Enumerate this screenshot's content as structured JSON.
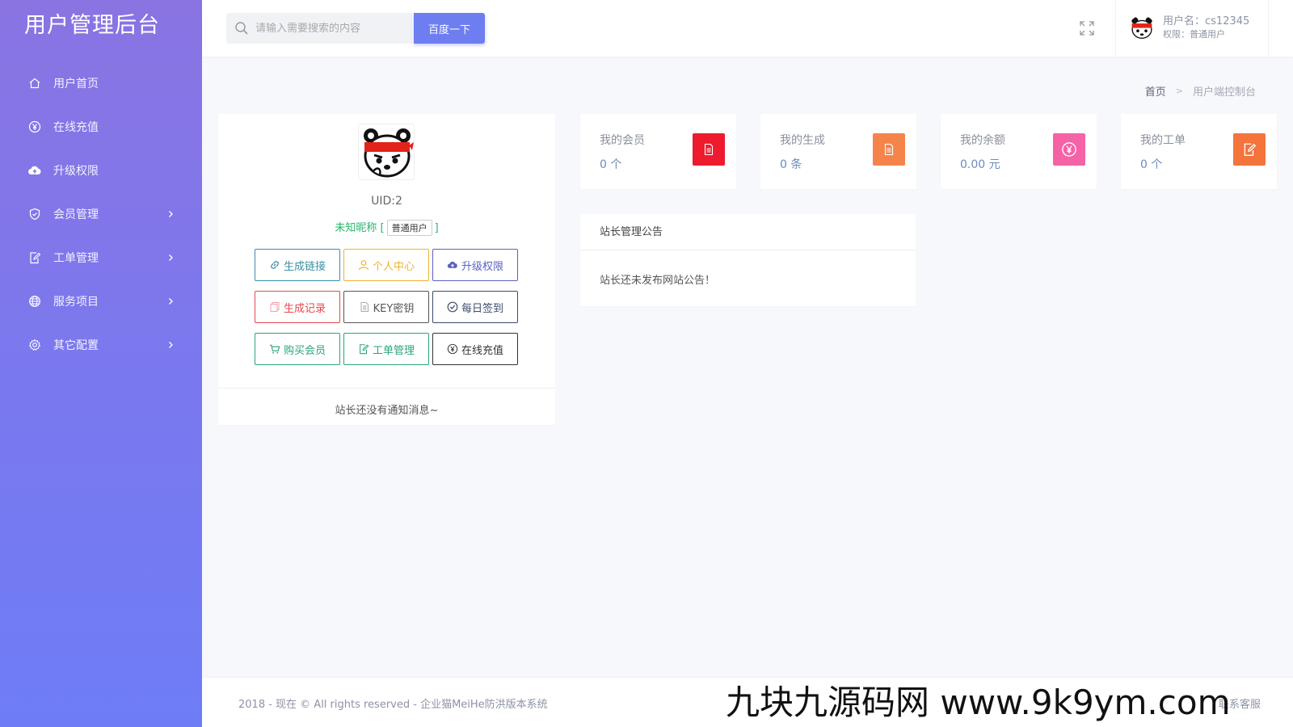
{
  "brand": "用户管理后台",
  "sidebar": {
    "items": [
      {
        "label": "用户首页",
        "icon": "home-icon",
        "has_arrow": false
      },
      {
        "label": "在线充值",
        "icon": "yen-circle-icon",
        "has_arrow": false
      },
      {
        "label": "升级权限",
        "icon": "cloud-upload-icon",
        "has_arrow": false
      },
      {
        "label": "会员管理",
        "icon": "shield-check-icon",
        "has_arrow": true
      },
      {
        "label": "工单管理",
        "icon": "edit-document-icon",
        "has_arrow": true
      },
      {
        "label": "服务项目",
        "icon": "globe-icon",
        "has_arrow": true
      },
      {
        "label": "其它配置",
        "icon": "gear-icon",
        "has_arrow": true
      }
    ]
  },
  "header": {
    "search_placeholder": "请输入需要搜索的内容",
    "search_button": "百度一下",
    "username": "用户名：cs12345",
    "role": "权限：普通用户"
  },
  "breadcrumb": {
    "home": "首页",
    "current": "用户端控制台"
  },
  "profile": {
    "uid": "UID:2",
    "nickname": "未知昵称",
    "role_badge": "普通用户",
    "buttons": [
      {
        "label": "生成链接",
        "icon": "link-icon",
        "color": "#3a8fa6"
      },
      {
        "label": "个人中心",
        "icon": "user-icon",
        "color": "#f2b233"
      },
      {
        "label": "升级权限",
        "icon": "cloud-upload-icon",
        "color": "#5a63c0"
      },
      {
        "label": "生成记录",
        "icon": "copy-icon",
        "color": "#e6474f"
      },
      {
        "label": "KEY密钥",
        "icon": "document-icon",
        "color": "#555555"
      },
      {
        "label": "每日签到",
        "icon": "check-circle-icon",
        "color": "#3c4a6b"
      },
      {
        "label": "购买会员",
        "icon": "cart-icon",
        "color": "#2aa57a"
      },
      {
        "label": "工单管理",
        "icon": "edit-document-icon",
        "color": "#2aa57a"
      },
      {
        "label": "在线充值",
        "icon": "yen-circle-icon",
        "color": "#333333"
      }
    ],
    "notice": "站长还没有通知消息~"
  },
  "stats": [
    {
      "label": "我的会员",
      "value": "0 个",
      "icon": "document-icon",
      "color": "#ee1b2e"
    },
    {
      "label": "我的生成",
      "value": "0 条",
      "icon": "document-icon",
      "color": "#f5844b"
    },
    {
      "label": "我的余额",
      "value": "0.00 元",
      "icon": "yen-circle-icon",
      "color": "#f562a6"
    },
    {
      "label": "我的工单",
      "value": "0 个",
      "icon": "edit-document-icon",
      "color": "#f4743c"
    }
  ],
  "announcement": {
    "title": "站长管理公告",
    "body": "站长还未发布网站公告！"
  },
  "footer": {
    "copyright": "2018 - 现在 © All rights reserved - 企业猫MeiHe防洪版本系统",
    "contact": "联系客服"
  },
  "watermark": "九块九源码网 www.9k9ym.com"
}
